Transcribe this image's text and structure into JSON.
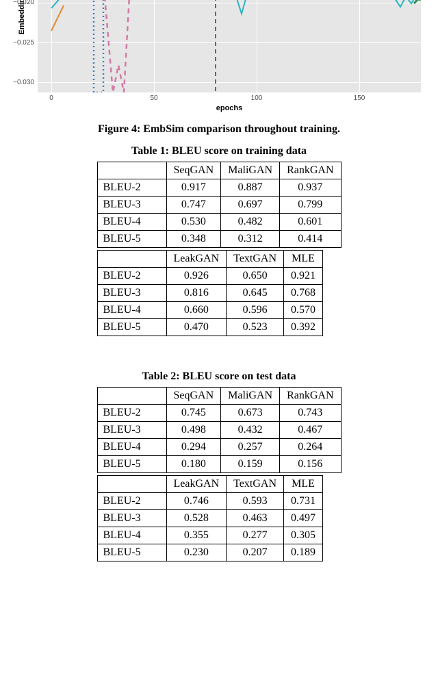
{
  "chart_data": {
    "type": "line",
    "title": "",
    "xlabel": "epochs",
    "ylabel": "Embedding s",
    "xlim": [
      0,
      180
    ],
    "ylim": [
      -0.032,
      -0.018
    ],
    "x_ticks": [
      0,
      50,
      100,
      150
    ],
    "y_ticks": [
      -0.02,
      -0.025,
      -0.03
    ],
    "note": "Only the lower cropped portion of the chart is visible in the image; series values are approximate readings from the visible pixels.",
    "series": [
      {
        "name": "cyan-solid",
        "color": "#2cb5c0",
        "style": "solid",
        "x": [
          0,
          5,
          90,
          94,
          96,
          170,
          175,
          178
        ],
        "y": [
          -0.019,
          -0.018,
          -0.018,
          -0.02,
          -0.018,
          -0.018,
          -0.019,
          -0.018
        ]
      },
      {
        "name": "orange-solid",
        "color": "#e6842a",
        "style": "solid",
        "x": [
          0,
          6
        ],
        "y": [
          -0.022,
          -0.019
        ]
      },
      {
        "name": "blue-dotted",
        "color": "#3f7fbf",
        "style": "dotted",
        "x": [
          20,
          20,
          25,
          25
        ],
        "y": [
          -0.018,
          -0.032,
          -0.032,
          -0.018
        ]
      },
      {
        "name": "pink-dashed",
        "color": "#d279a6",
        "style": "dashed",
        "x": [
          26,
          30,
          32,
          34,
          36
        ],
        "y": [
          -0.018,
          -0.032,
          -0.028,
          -0.032,
          -0.018
        ]
      },
      {
        "name": "gray-dashed",
        "color": "#666666",
        "style": "dashed",
        "x": [
          80,
          80
        ],
        "y": [
          -0.018,
          -0.032
        ]
      },
      {
        "name": "green-dot",
        "color": "#2e8b57",
        "style": "solid",
        "x": [
          178,
          180
        ],
        "y": [
          -0.0185,
          -0.018
        ]
      }
    ]
  },
  "figure4_caption": "Figure 4: EmbSim comparison throughout training.",
  "table1_caption": "Table 1: BLEU score on training data",
  "table2_caption": "Table 2: BLEU score on test data",
  "xlabel": "epochs",
  "ylabel_partial": "Embedding s",
  "x_tick_labels": {
    "t0": "0",
    "t1": "50",
    "t2": "100",
    "t3": "150"
  },
  "y_tick_labels": {
    "y0": "−0.020",
    "y1": "−0.025",
    "y2": "−0.030"
  },
  "tables": {
    "t1": {
      "hdrA": [
        "",
        "SeqGAN",
        "MaliGAN",
        "RankGAN"
      ],
      "rowsA": [
        {
          "m": "BLEU-2",
          "c0": "0.917",
          "c1": "0.887",
          "c2": "0.937",
          "b2": true
        },
        {
          "m": "BLEU-3",
          "c0": "0.747",
          "c1": "0.697",
          "c2": "0.799"
        },
        {
          "m": "BLEU-4",
          "c0": "0.530",
          "c1": "0.482",
          "c2": "0.601"
        },
        {
          "m": "BLEU-5",
          "c0": "0.348",
          "c1": "0.312",
          "c2": "0.414"
        }
      ],
      "hdrB": [
        "",
        "LeakGAN",
        "TextGAN",
        "MLE"
      ],
      "rowsB": [
        {
          "m": "BLEU-2",
          "c0": "0.926",
          "c1": "0.650",
          "c2": "0.921"
        },
        {
          "m": "BLEU-3",
          "c0": "0.816",
          "c1": "0.645",
          "c2": "0.768",
          "b0": true
        },
        {
          "m": "BLEU-4",
          "c0": "0.660",
          "c1": "0.596",
          "c2": "0.570",
          "b0": true
        },
        {
          "m": "BLEU-5",
          "c0": "0.470",
          "c1": "0.523",
          "c2": "0.392",
          "b1": true
        }
      ]
    },
    "t2": {
      "hdrA": [
        "",
        "SeqGAN",
        "MaliGAN",
        "RankGAN"
      ],
      "rowsA": [
        {
          "m": "BLEU-2",
          "c0": "0.745",
          "c1": "0.673",
          "c2": "0.743"
        },
        {
          "m": "BLEU-3",
          "c0": "0.498",
          "c1": "0.432",
          "c2": "0.467"
        },
        {
          "m": "BLEU-4",
          "c0": "0.294",
          "c1": "0.257",
          "c2": "0.264"
        },
        {
          "m": "BLEU-5",
          "c0": "0.180",
          "c1": "0.159",
          "c2": "0.156"
        }
      ],
      "hdrB": [
        "",
        "LeakGAN",
        "TextGAN",
        "MLE"
      ],
      "rowsB": [
        {
          "m": "BLEU-2",
          "c0": "0.746",
          "c1": "0.593",
          "c2": "0.731",
          "b0": true
        },
        {
          "m": "BLEU-3",
          "c0": "0.528",
          "c1": "0.463",
          "c2": "0.497",
          "b0": true
        },
        {
          "m": "BLEU-4",
          "c0": "0.355",
          "c1": "0.277",
          "c2": "0.305",
          "b0": true
        },
        {
          "m": "BLEU-5",
          "c0": "0.230",
          "c1": "0.207",
          "c2": "0.189",
          "b0": true
        }
      ]
    }
  }
}
